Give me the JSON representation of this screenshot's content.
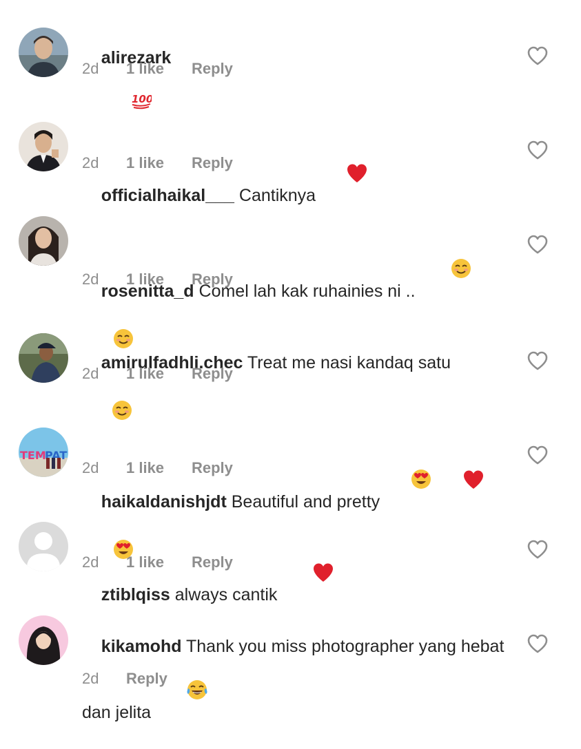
{
  "comments": [
    {
      "username": "alirezark",
      "text": "",
      "emoji": [
        "hundred"
      ],
      "time": "2d",
      "likes": "1 like",
      "reply": "Reply",
      "avatar": "avatar-man-outdoor"
    },
    {
      "username": "officialhaikal___",
      "text": "Cantiknya",
      "emoji": [
        "red-heart"
      ],
      "time": "2d",
      "likes": "1 like",
      "reply": "Reply",
      "avatar": "avatar-man-suit"
    },
    {
      "username": "rosenitta_d",
      "text": "Comel lah kak ruhainies ni ..",
      "emoji": [
        "smiling-face",
        "smiling-face",
        "smiling-face"
      ],
      "time": "2d",
      "likes": "1 like",
      "reply": "Reply",
      "avatar": "avatar-woman-car"
    },
    {
      "username": "amirulfadhli.chec",
      "text": "Treat me nasi kandaq satu",
      "emoji": [],
      "time": "2d",
      "likes": "1 like",
      "reply": "Reply",
      "avatar": "avatar-man-cap"
    },
    {
      "username": "haikaldanishjdt",
      "text": "Beautiful and pretty",
      "emoji": [
        "heart-eyes",
        "red-heart",
        "heart-eyes"
      ],
      "time": "2d",
      "likes": "1 like",
      "reply": "Reply",
      "avatar": "avatar-group-sign"
    },
    {
      "username": "ztiblqiss",
      "text": "always cantik",
      "emoji": [
        "red-heart"
      ],
      "time": "2d",
      "likes": "1 like",
      "reply": "Reply",
      "avatar": "avatar-default"
    },
    {
      "username": "kikamohd",
      "text": "Thank you miss photographer yang hebat dan jelita",
      "emoji": [
        "tears-of-joy"
      ],
      "time": "2d",
      "likes": "",
      "reply": "Reply",
      "avatar": "avatar-woman-hijab"
    }
  ],
  "colors": {
    "text": "#262626",
    "meta": "#8e8e8e",
    "heart_outline": "#8e8e8e",
    "background": "#ffffff"
  },
  "icons": {
    "like": "heart-outline-icon"
  }
}
